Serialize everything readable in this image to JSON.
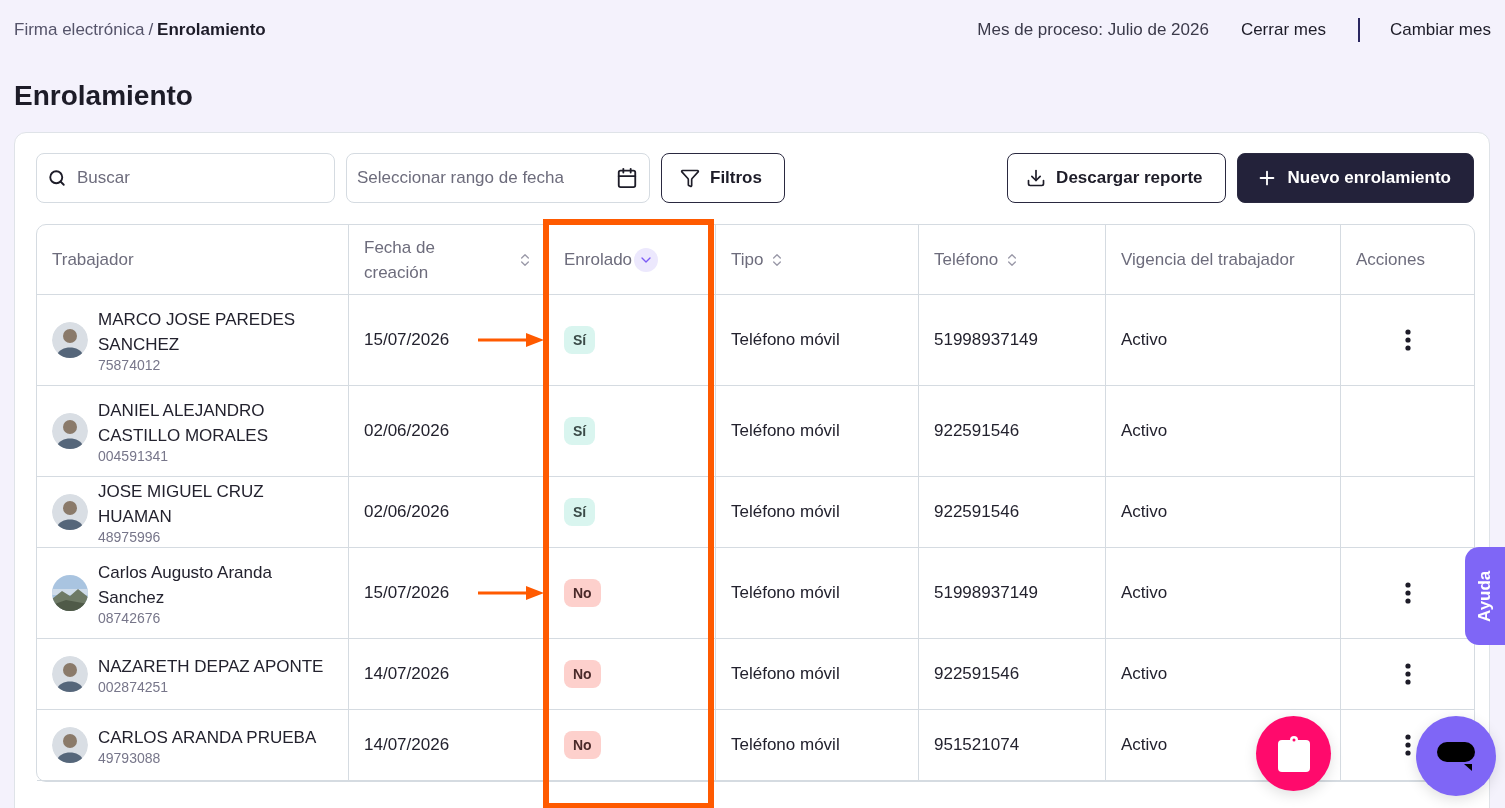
{
  "breadcrumb": {
    "parent": "Firma electrónica",
    "separator": "/",
    "current": "Enrolamiento"
  },
  "header_actions": {
    "process_month": "Mes de proceso: Julio de 2026",
    "close_month": "Cerrar mes",
    "change_month": "Cambiar mes"
  },
  "page_title": "Enrolamiento",
  "toolbar": {
    "search": {
      "placeholder": "Buscar"
    },
    "date_range": {
      "placeholder": "Seleccionar rango de fecha"
    },
    "filters": "Filtros",
    "download": "Descargar reporte",
    "new": "Nuevo enrolamiento"
  },
  "table": {
    "columns": [
      {
        "label": "Trabajador",
        "kind": "plain",
        "highlighted": false
      },
      {
        "label": "Fecha de creación",
        "kind": "sortable",
        "highlighted": false
      },
      {
        "label": "Enrolado",
        "kind": "sorted",
        "highlighted": true
      },
      {
        "label": "Tipo",
        "kind": "sortable",
        "highlighted": false
      },
      {
        "label": "Teléfono",
        "kind": "sortable",
        "highlighted": false
      },
      {
        "label": "Vigencia del trabajador",
        "kind": "plain",
        "highlighted": false
      },
      {
        "label": "Acciones",
        "kind": "plain",
        "highlighted": false
      }
    ],
    "rows": [
      {
        "kind": "avatar",
        "name": "MARCO JOSE PAREDES SANCHEZ",
        "id": "75874012",
        "date": "15/07/2026",
        "enrolled": true,
        "enrolled_label": "Sí",
        "type": "Teléfono móvil",
        "phone": "51998937149",
        "status": "Activo",
        "actions": true,
        "arrow": true
      },
      {
        "kind": "avatar",
        "name": "DANIEL ALEJANDRO CASTILLO MORALES",
        "id": "004591341",
        "date": "02/06/2026",
        "enrolled": true,
        "enrolled_label": "Sí",
        "type": "Teléfono móvil",
        "phone": "922591546",
        "status": "Activo",
        "actions": false,
        "arrow": false
      },
      {
        "kind": "avatar",
        "name": "JOSE MIGUEL CRUZ HUAMAN",
        "id": "48975996",
        "date": "02/06/2026",
        "enrolled": true,
        "enrolled_label": "Sí",
        "type": "Teléfono móvil",
        "phone": "922591546",
        "status": "Activo",
        "actions": false,
        "arrow": false
      },
      {
        "kind": "picture",
        "name": "Carlos Augusto Aranda Sanchez",
        "id": "08742676",
        "date": "15/07/2026",
        "enrolled": false,
        "enrolled_label": "No",
        "type": "Teléfono móvil",
        "phone": "51998937149",
        "status": "Activo",
        "actions": true,
        "arrow": true
      },
      {
        "kind": "avatar",
        "name": "NAZARETH DEPAZ APONTE",
        "id": "002874251",
        "date": "14/07/2026",
        "enrolled": false,
        "enrolled_label": "No",
        "type": "Teléfono móvil",
        "phone": "922591546",
        "status": "Activo",
        "actions": true,
        "arrow": false
      },
      {
        "kind": "avatar",
        "name": "CARLOS ARANDA PRUEBA",
        "id": "49793088",
        "date": "14/07/2026",
        "enrolled": false,
        "enrolled_label": "No",
        "type": "Teléfono móvil",
        "phone": "951521074",
        "status": "Activo",
        "actions": true,
        "arrow": false
      }
    ]
  },
  "help_tab": "Ayuda"
}
